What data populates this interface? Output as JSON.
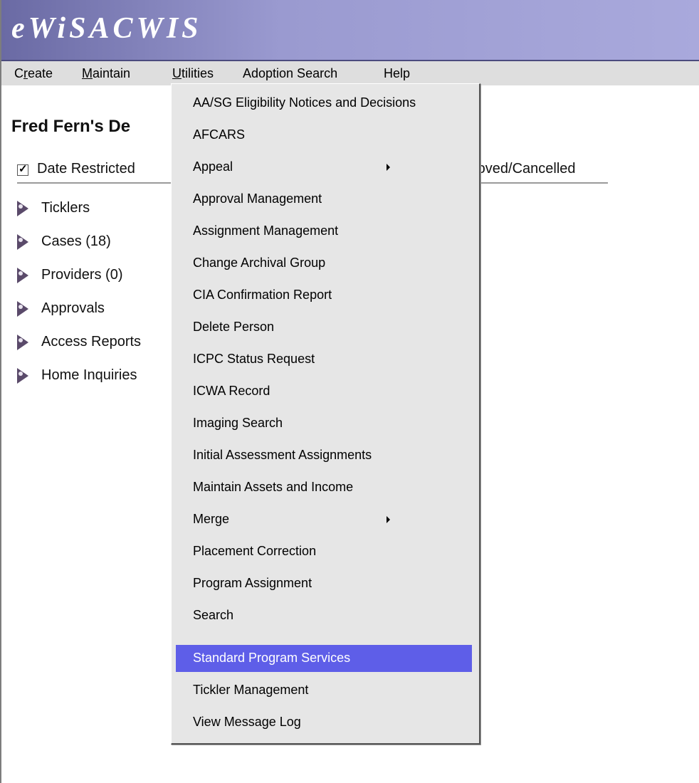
{
  "app": {
    "title": "eWiSACWIS"
  },
  "menubar": {
    "items": [
      {
        "accel": "",
        "rest_prefix": "C",
        "accel_char": "r",
        "rest": "eate"
      },
      {
        "accel_char": "M",
        "rest": "aintain"
      },
      {
        "accel_char": "U",
        "rest": "tilities"
      },
      {
        "label": "Adoption Search"
      },
      {
        "label": "Help"
      }
    ]
  },
  "page": {
    "heading": "Fred Fern's De",
    "filter_label": "Date Restricted",
    "filter_checked": "✓",
    "status_label_fragment": "roved/Cancelled"
  },
  "tree": {
    "items": [
      {
        "label": "Ticklers"
      },
      {
        "label": "Cases (18)"
      },
      {
        "label": "Providers (0)"
      },
      {
        "label": "Approvals"
      },
      {
        "label": "Access Reports"
      },
      {
        "label": "Home Inquiries"
      }
    ]
  },
  "utilities_menu": {
    "items": [
      {
        "label": "AA/SG Eligibility Notices and Decisions"
      },
      {
        "label": "AFCARS"
      },
      {
        "label": "Appeal",
        "submenu": true
      },
      {
        "label": "Approval Management"
      },
      {
        "label": "Assignment Management"
      },
      {
        "label": "Change Archival Group"
      },
      {
        "label": "CIA Confirmation Report"
      },
      {
        "label": "Delete Person"
      },
      {
        "label": "ICPC Status Request"
      },
      {
        "label": "ICWA Record"
      },
      {
        "label": "Imaging Search"
      },
      {
        "label": "Initial Assessment Assignments"
      },
      {
        "label": "Maintain Assets and Income"
      },
      {
        "label": "Merge",
        "submenu": true
      },
      {
        "label": "Placement Correction"
      },
      {
        "label": "Program Assignment"
      },
      {
        "label": "Search"
      },
      {
        "label": "Standard Program Services",
        "selected": true
      },
      {
        "label": "Tickler Management"
      },
      {
        "label": "View Message Log"
      }
    ]
  }
}
